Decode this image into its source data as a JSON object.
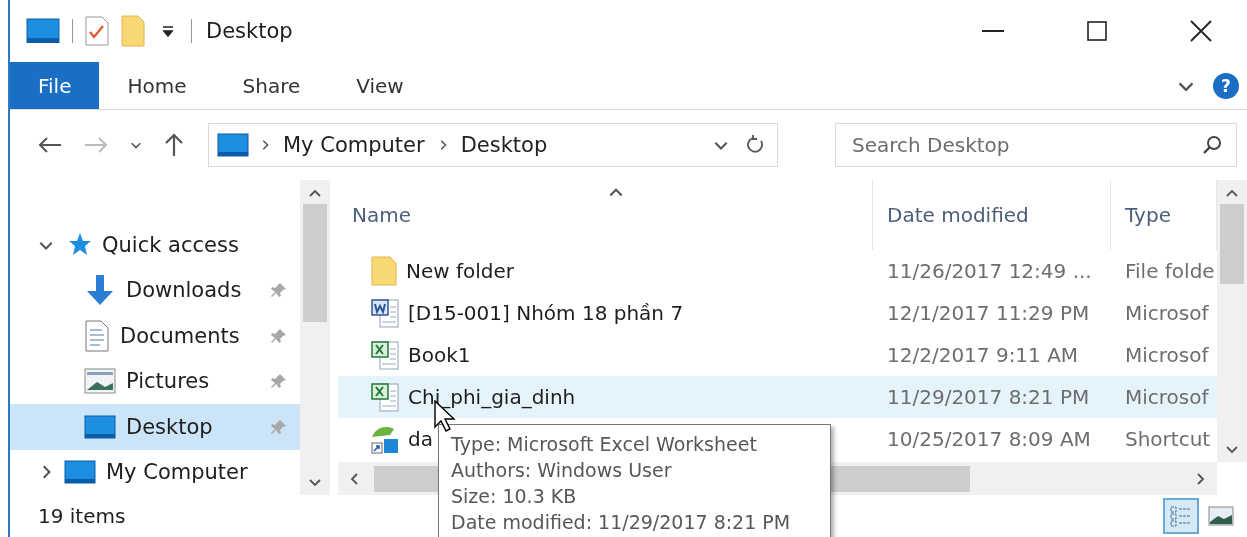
{
  "window": {
    "title": "Desktop"
  },
  "ribbon": {
    "tabs": [
      {
        "label": "File",
        "selected": true
      },
      {
        "label": "Home",
        "selected": false
      },
      {
        "label": "Share",
        "selected": false
      },
      {
        "label": "View",
        "selected": false
      }
    ],
    "help": "?"
  },
  "address": {
    "crumbs": [
      "My Computer",
      "Desktop"
    ]
  },
  "search": {
    "placeholder": "Search Desktop"
  },
  "sidebar": {
    "items": [
      {
        "label": "Quick access",
        "kind": "star",
        "expanded": true,
        "selected": false,
        "children": [
          {
            "label": "Downloads",
            "kind": "download",
            "pinned": true,
            "selected": false
          },
          {
            "label": "Documents",
            "kind": "document",
            "pinned": true,
            "selected": false
          },
          {
            "label": "Pictures",
            "kind": "picture",
            "pinned": true,
            "selected": false
          },
          {
            "label": "Desktop",
            "kind": "desktop",
            "pinned": true,
            "selected": true
          }
        ]
      },
      {
        "label": "My Computer",
        "kind": "computer",
        "expanded": false,
        "selected": false
      }
    ]
  },
  "table": {
    "columns": [
      "Name",
      "Date modified",
      "Type"
    ],
    "rows": [
      {
        "kind": "folder",
        "name": "New folder",
        "date": "11/26/2017 12:49 ...",
        "type": "File folde",
        "selected": false
      },
      {
        "kind": "word",
        "name": "[D15-001] Nhóm 18 phần 7",
        "date": "12/1/2017 11:29 PM",
        "type": "Microsof",
        "selected": false
      },
      {
        "kind": "excel",
        "name": "Book1",
        "date": "12/2/2017 9:11 AM",
        "type": "Microsof",
        "selected": false
      },
      {
        "kind": "excel",
        "name": "Chi_phi_gia_dinh",
        "date": "11/29/2017 8:21 PM",
        "type": "Microsof",
        "selected": true
      },
      {
        "kind": "shortcut",
        "name": "da",
        "date": "10/25/2017 8:09 AM",
        "type": "Shortcut",
        "selected": false
      }
    ]
  },
  "tooltip": {
    "lines": [
      "Type: Microsoft Excel Worksheet",
      "Authors: Windows User",
      "Size: 10.3 KB",
      "Date modified: 11/29/2017 8:21 PM"
    ]
  },
  "status_bar": {
    "count": "19 items",
    "views": [
      {
        "kind": "details",
        "selected": true
      },
      {
        "kind": "thumbnails",
        "selected": false
      }
    ]
  }
}
